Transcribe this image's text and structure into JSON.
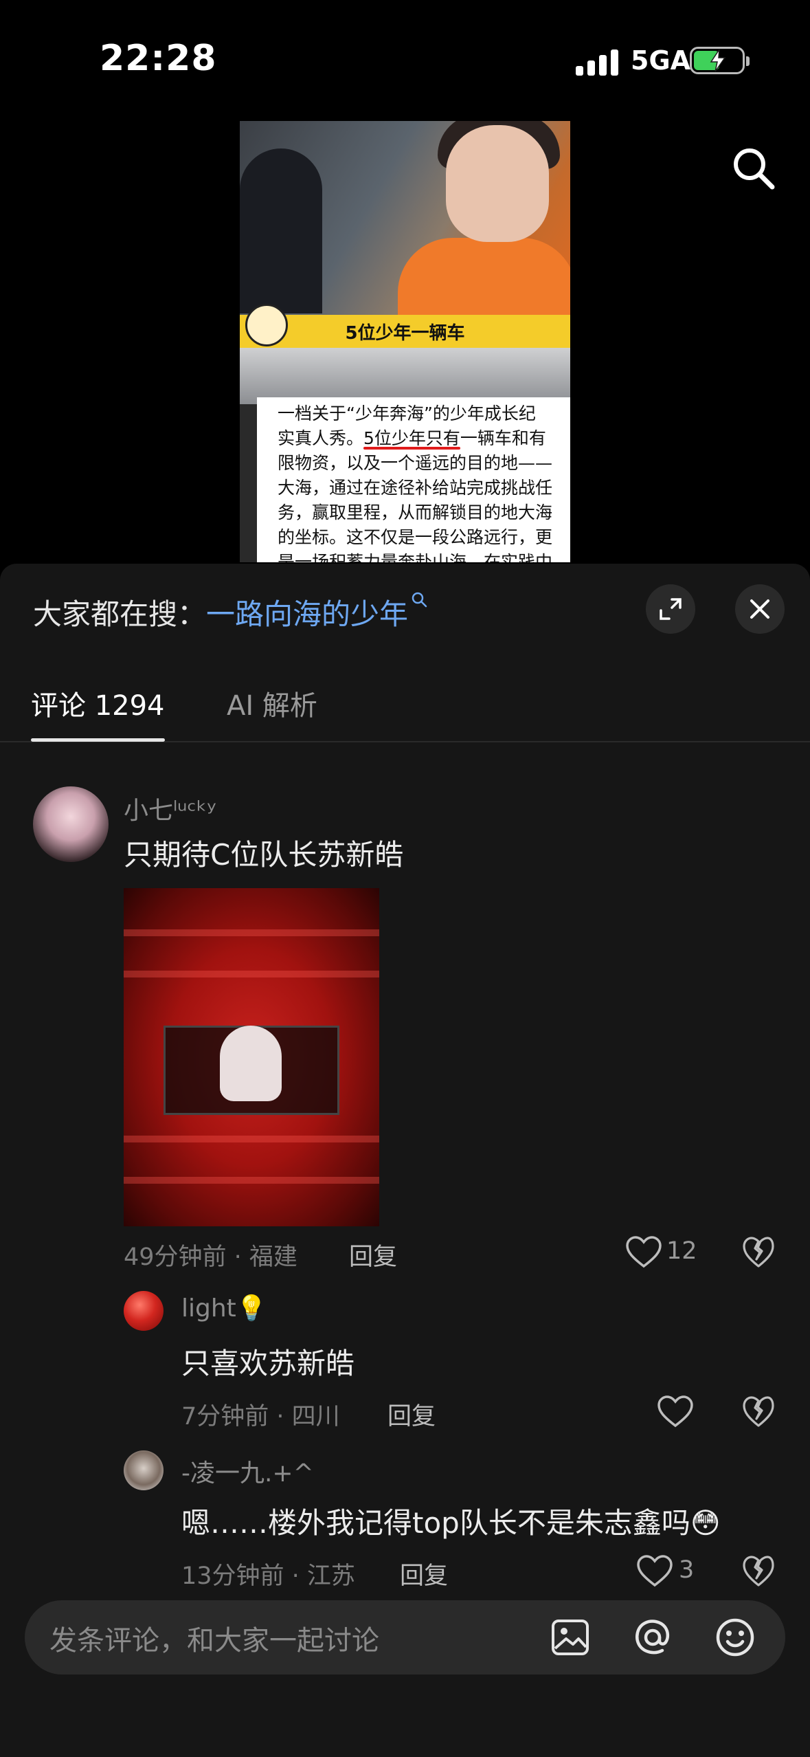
{
  "status_bar": {
    "time": "22:28",
    "network": "5GA",
    "battery_level": 0.55
  },
  "video": {
    "banner_text": "5位少年一辆车",
    "caption_lines": [
      "一档关于“少年奔海”的少年成长纪",
      "实真人秀。5位少年只有一辆车和有",
      "限物资，以及一个遥远的目的地——",
      "大海，通过在途径补给站完成挑战任",
      "务，赢取里程，从而解锁目的地大海",
      "的坐标。这不仅是一段公路远行，更",
      "是一场积蓄力量奔赴山海，在实践中"
    ],
    "caption_line2_a": "实真人秀。",
    "caption_line2_u": "5位少年只有",
    "caption_line2_b": "一辆车和有"
  },
  "panel": {
    "hot_search_prefix": "大家都在搜：",
    "hot_search_link": "一路向海的少年",
    "tabs": [
      {
        "label": "评论 1294",
        "active": true
      },
      {
        "label": "AI 解析",
        "active": false
      }
    ]
  },
  "comments": [
    {
      "username": "小七ˡᵘᶜᵏʸ",
      "text": "只期待C位队长苏新皓",
      "time": "49分钟前 · 福建",
      "reply_label": "回复",
      "likes": "12"
    },
    {
      "username": "light💡",
      "text": "只喜欢苏新皓",
      "time": "7分钟前 · 四川",
      "reply_label": "回复",
      "likes": ""
    },
    {
      "username": "-凌一九.+^",
      "text": "嗯……楼外我记得top队长不是朱志鑫吗😳",
      "time": "13分钟前 · 江苏",
      "reply_label": "回复",
      "likes": "3"
    }
  ],
  "input": {
    "placeholder": "发条评论，和大家一起讨论"
  },
  "icons": {
    "search": "search-icon",
    "expand": "expand-icon",
    "close": "close-icon",
    "like": "heart-outline-icon",
    "dislike": "broken-heart-icon",
    "image": "image-icon",
    "mention": "at-icon",
    "emoji": "emoji-icon"
  },
  "colors": {
    "link": "#6ea8f2",
    "panel_bg": "#161616",
    "battery": "#3fd15a"
  }
}
